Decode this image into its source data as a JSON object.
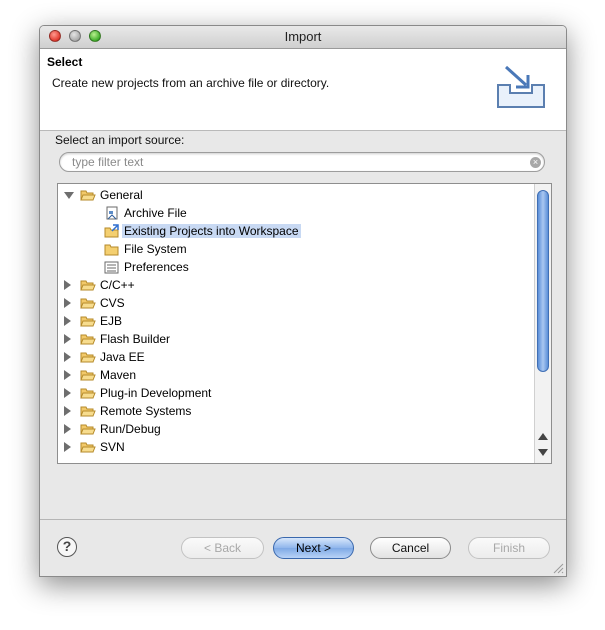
{
  "window": {
    "title": "Import"
  },
  "banner": {
    "title": "Select",
    "description": "Create new projects from an archive file or directory."
  },
  "source": {
    "label": "Select an import source:",
    "filter_placeholder": "type filter text",
    "clear_glyph": "×"
  },
  "tree": {
    "items": [
      {
        "label": "General",
        "level": 0,
        "expanded": true,
        "icon": "folder-open-icon"
      },
      {
        "label": "Archive File",
        "level": 1,
        "icon": "archive-file-icon"
      },
      {
        "label": "Existing Projects into Workspace",
        "level": 1,
        "icon": "project-import-icon",
        "selected": true
      },
      {
        "label": "File System",
        "level": 1,
        "icon": "folder-icon"
      },
      {
        "label": "Preferences",
        "level": 1,
        "icon": "preferences-icon"
      },
      {
        "label": "C/C++",
        "level": 0,
        "expanded": false,
        "icon": "folder-open-icon"
      },
      {
        "label": "CVS",
        "level": 0,
        "expanded": false,
        "icon": "folder-open-icon"
      },
      {
        "label": "EJB",
        "level": 0,
        "expanded": false,
        "icon": "folder-open-icon"
      },
      {
        "label": "Flash Builder",
        "level": 0,
        "expanded": false,
        "icon": "folder-open-icon"
      },
      {
        "label": "Java EE",
        "level": 0,
        "expanded": false,
        "icon": "folder-open-icon"
      },
      {
        "label": "Maven",
        "level": 0,
        "expanded": false,
        "icon": "folder-open-icon"
      },
      {
        "label": "Plug-in Development",
        "level": 0,
        "expanded": false,
        "icon": "folder-open-icon"
      },
      {
        "label": "Remote Systems",
        "level": 0,
        "expanded": false,
        "icon": "folder-open-icon"
      },
      {
        "label": "Run/Debug",
        "level": 0,
        "expanded": false,
        "icon": "folder-open-icon"
      },
      {
        "label": "SVN",
        "level": 0,
        "expanded": false,
        "icon": "folder-open-icon"
      }
    ]
  },
  "buttons": {
    "help_glyph": "?",
    "back": "< Back",
    "next": "Next >",
    "cancel": "Cancel",
    "finish": "Finish"
  },
  "colors": {
    "selection": "#c8d9f3",
    "primary_button": "#8fb6ec",
    "scroll_thumb": "#5b8fd8"
  }
}
